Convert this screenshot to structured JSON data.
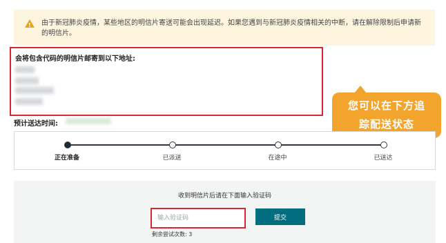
{
  "notice": {
    "icon": "warning-icon",
    "text": "由于新冠肺炎疫情，某些地区的明信片寄送可能会出现延迟。如果您遇到与新冠肺炎疫情相关的中断，请在解除限制后申请新的明信片。"
  },
  "address": {
    "title": "会将包含代码的明信片邮寄到以下地址:"
  },
  "tooltip": {
    "line1": "您可以在下方追",
    "line2": "踪配送状态"
  },
  "eta": {
    "label": "预计送达时间:"
  },
  "tracker": {
    "steps": [
      {
        "label": "正在准备",
        "active": true
      },
      {
        "label": "已派送",
        "active": false
      },
      {
        "label": "在途中",
        "active": false
      },
      {
        "label": "已送达",
        "active": false
      }
    ]
  },
  "verify": {
    "title": "收到明信片后请在下面输入验证码",
    "placeholder": "输入验证码",
    "submit_label": "提交",
    "attempts_text": "剩余尝试次数: 3"
  },
  "colors": {
    "highlight": "#d72631",
    "tooltip": "#f2a42d",
    "button": "#006e7f"
  }
}
